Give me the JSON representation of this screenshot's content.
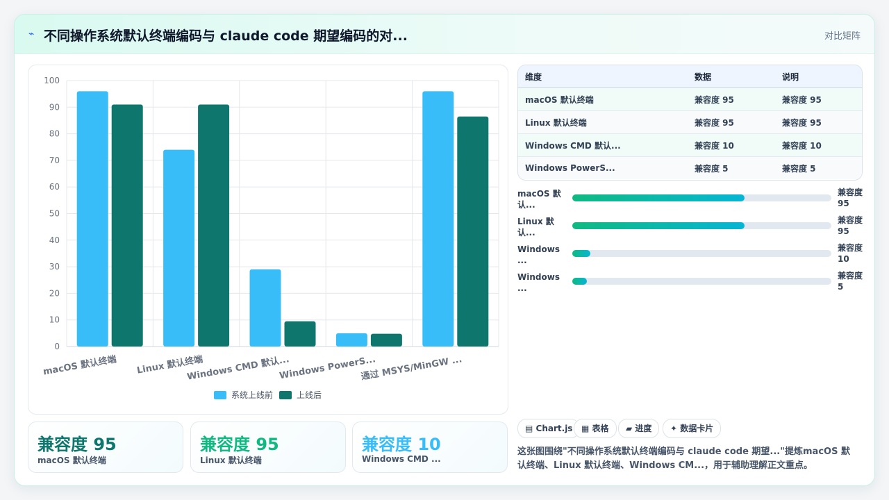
{
  "header": {
    "icon": "pulse-icon",
    "title": "不同操作系统默认终端编码与 claude code 期望编码的对...",
    "mode": "对比矩阵"
  },
  "chart_data": {
    "type": "bar",
    "categories": [
      "macOS 默认终端",
      "Linux 默认终端",
      "Windows CMD 默认...",
      "Windows PowerS...",
      "通过 MSYS/MinGW ..."
    ],
    "series": [
      {
        "name": "系统上线前",
        "values": [
          96,
          74,
          29,
          5,
          96
        ],
        "color": "#38bdf8"
      },
      {
        "name": "上线后",
        "values": [
          91,
          91,
          9.5,
          4.8,
          86.5
        ],
        "color": "#0f766e"
      }
    ],
    "ylim": [
      0,
      100
    ],
    "yticks": [
      0,
      10,
      20,
      30,
      40,
      50,
      60,
      70,
      80,
      90,
      100
    ],
    "grid": true,
    "legend_position": "bottom"
  },
  "stats": [
    {
      "value": "兼容度 95",
      "label": "macOS 默认终端",
      "color": "#0f766e"
    },
    {
      "value": "兼容度 95",
      "label": "Linux 默认终端",
      "color": "#10b981"
    },
    {
      "value": "兼容度 10",
      "label": "Windows CMD ...",
      "color": "#38bdf8"
    }
  ],
  "table": {
    "headers": [
      "维度",
      "数据",
      "说明"
    ],
    "rows": [
      [
        "macOS 默认终端",
        "兼容度 95",
        "兼容度 95"
      ],
      [
        "Linux 默认终端",
        "兼容度 95",
        "兼容度 95"
      ],
      [
        "Windows CMD 默认...",
        "兼容度 10",
        "兼容度 10"
      ],
      [
        "Windows PowerS...",
        "兼容度 5",
        "兼容度 5"
      ]
    ]
  },
  "progress": [
    {
      "label": "macOS 默认...",
      "value": "兼容度 95",
      "percent": 66.5
    },
    {
      "label": "Linux 默认...",
      "value": "兼容度 95",
      "percent": 66.5
    },
    {
      "label": "Windows ...",
      "value": "兼容度 10",
      "percent": 7
    },
    {
      "label": "Windows ...",
      "value": "兼容度 5",
      "percent": 5.6
    }
  ],
  "tags": [
    {
      "icon": "chart-icon",
      "glyph": "▤",
      "label": "Chart.js"
    },
    {
      "icon": "table-icon",
      "glyph": "▦",
      "label": "表格"
    },
    {
      "icon": "progress-icon",
      "glyph": "▰",
      "label": "进度"
    },
    {
      "icon": "sparkle-icon",
      "glyph": "✦",
      "label": "数据卡片"
    }
  ],
  "description": "这张图围绕\"不同操作系统默认终端编码与 claude code 期望...\"提炼macOS 默认终端、Linux 默认终端、Windows CM...，用于辅助理解正文重点。"
}
